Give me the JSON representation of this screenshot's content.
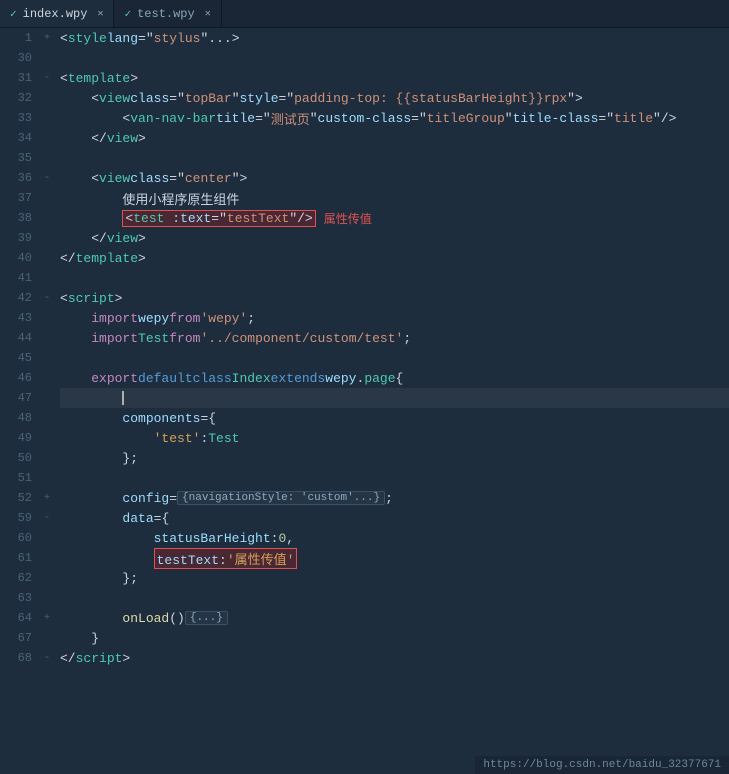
{
  "tabs": [
    {
      "label": "index.wpy",
      "active": true,
      "icon": "✓"
    },
    {
      "label": "test.wpy",
      "active": false,
      "icon": "✓"
    }
  ],
  "lines": [
    {
      "num": 1,
      "fold": "+",
      "content": "style_tag"
    },
    {
      "num": 30,
      "fold": "",
      "content": "blank"
    },
    {
      "num": 31,
      "fold": "-",
      "content": "template_open"
    },
    {
      "num": 32,
      "fold": "",
      "content": "view_topbar"
    },
    {
      "num": 33,
      "fold": "",
      "content": "van_nav"
    },
    {
      "num": 34,
      "fold": "",
      "content": "view_close"
    },
    {
      "num": 35,
      "fold": "",
      "content": "blank"
    },
    {
      "num": 36,
      "fold": "-",
      "content": "view_center"
    },
    {
      "num": 37,
      "fold": "",
      "content": "comment_native"
    },
    {
      "num": 38,
      "fold": "",
      "content": "test_tag"
    },
    {
      "num": 39,
      "fold": "",
      "content": "view_close2"
    },
    {
      "num": 40,
      "fold": "",
      "content": "template_close"
    },
    {
      "num": 41,
      "fold": "",
      "content": "blank"
    },
    {
      "num": 42,
      "fold": "-",
      "content": "script_open"
    },
    {
      "num": 43,
      "fold": "",
      "content": "import_wepy"
    },
    {
      "num": 44,
      "fold": "",
      "content": "import_test"
    },
    {
      "num": 45,
      "fold": "",
      "content": "blank"
    },
    {
      "num": 46,
      "fold": "",
      "content": "export_class"
    },
    {
      "num": 47,
      "fold": "",
      "content": "blank_cursor"
    },
    {
      "num": 48,
      "fold": "",
      "content": "components_open"
    },
    {
      "num": 49,
      "fold": "",
      "content": "test_component"
    },
    {
      "num": 50,
      "fold": "",
      "content": "components_close"
    },
    {
      "num": 51,
      "fold": "",
      "content": "blank"
    },
    {
      "num": 52,
      "fold": "+",
      "content": "config_line"
    },
    {
      "num": 59,
      "fold": "-",
      "content": "data_open"
    },
    {
      "num": 60,
      "fold": "",
      "content": "status_bar"
    },
    {
      "num": 61,
      "fold": "",
      "content": "test_text"
    },
    {
      "num": 62,
      "fold": "",
      "content": "data_close"
    },
    {
      "num": 63,
      "fold": "",
      "content": "blank"
    },
    {
      "num": 64,
      "fold": "+",
      "content": "onload"
    },
    {
      "num": 67,
      "fold": "",
      "content": "class_close"
    },
    {
      "num": 68,
      "fold": "-",
      "content": "script_close"
    }
  ],
  "keywords": {
    "import": "import",
    "from": "from",
    "export": "export",
    "default": "default",
    "class": "class",
    "extends": "extends"
  },
  "bottom_url": "https://blog.csdn.net/baidu_32377671"
}
